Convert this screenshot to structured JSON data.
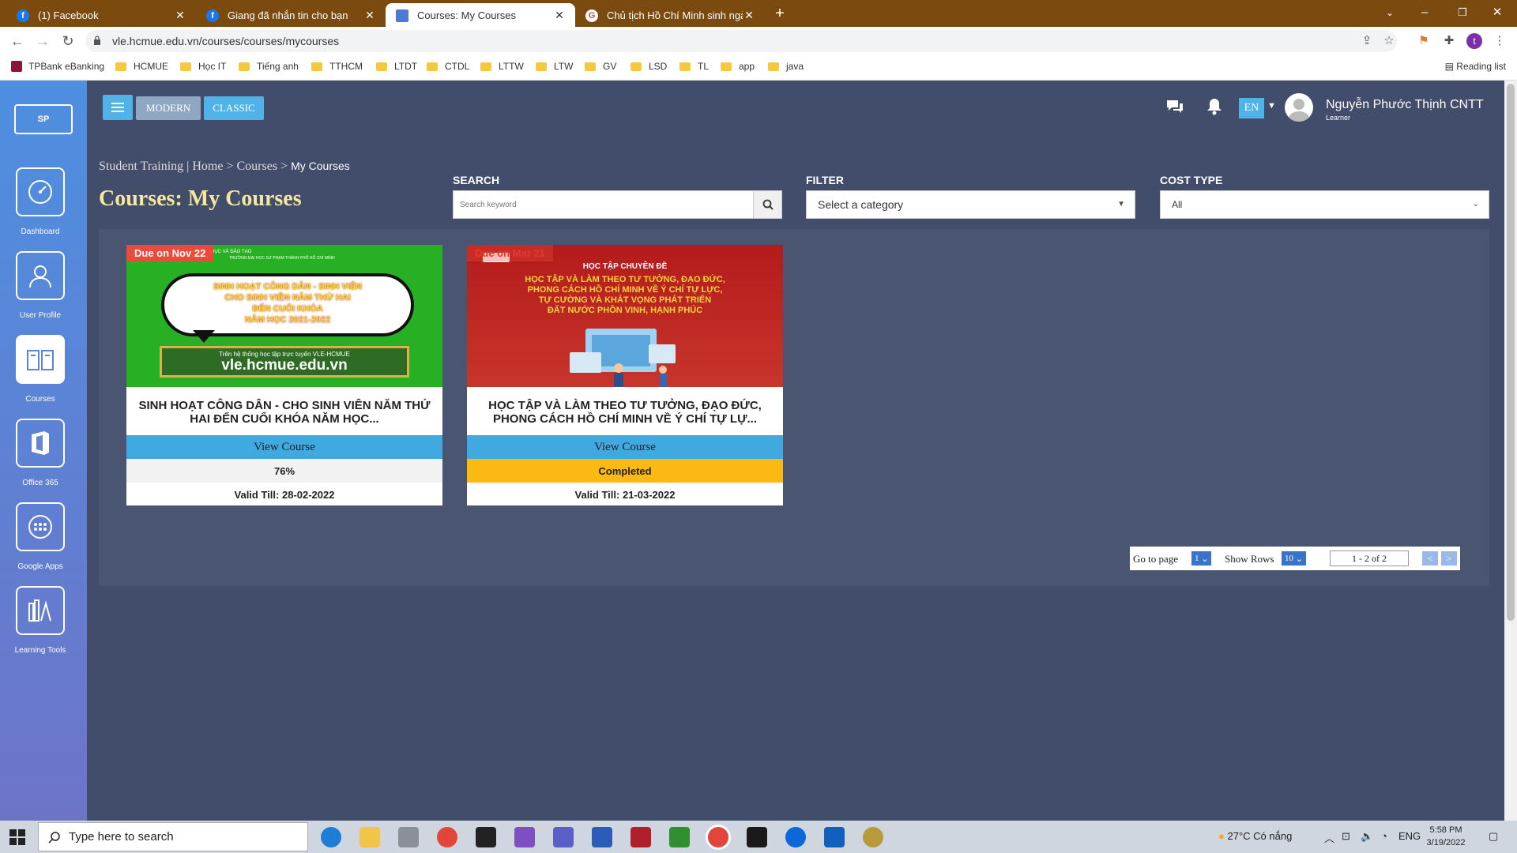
{
  "browser": {
    "tabs": [
      {
        "title": "(1) Facebook",
        "icon": "facebook-icon",
        "color": "#1877f2"
      },
      {
        "title": "Giang đã nhắn tin cho bạn",
        "icon": "facebook-icon",
        "color": "#1877f2"
      },
      {
        "title": "Courses: My Courses",
        "icon": "vle-icon",
        "color": "#4e7ad6"
      },
      {
        "title": "Chủ tịch Hồ Chí Minh sinh ngày",
        "icon": "google-icon",
        "color": "#ea4335"
      }
    ],
    "active_tab": 2,
    "url": "vle.hcmue.edu.vn/courses/courses/mycourses",
    "bookmarks": [
      "TPBank eBanking",
      "HCMUE",
      "Học IT",
      "Tiếng anh",
      "TTHCM",
      "LTDT",
      "CTDL",
      "LTTW",
      "LTW",
      "GV",
      "LSD",
      "TL",
      "app",
      "java"
    ],
    "reading_list": "Reading list",
    "profile_initial": "t"
  },
  "sidebar": {
    "logo_text": "SP",
    "items": [
      {
        "label": "Dashboard",
        "icon": "dashboard-icon"
      },
      {
        "label": "User Profile",
        "icon": "user-profile-icon"
      },
      {
        "label": "Courses",
        "icon": "courses-icon",
        "active": true
      },
      {
        "label": "Office 365",
        "icon": "office-365-icon"
      },
      {
        "label": "Google Apps",
        "icon": "google-apps-icon"
      },
      {
        "label": "Learning Tools",
        "icon": "learning-tools-icon"
      }
    ]
  },
  "header": {
    "modern_label": "MODERN",
    "classic_label": "CLASSIC",
    "language": "EN",
    "user_name": "Nguyễn Phước Thịnh CNTT",
    "user_role": "Learner"
  },
  "breadcrumb": {
    "root": "Student Training",
    "separator": "|",
    "home": "Home",
    "arrow": ">",
    "courses": "Courses",
    "current": "My Courses"
  },
  "page_title": "Courses: My Courses",
  "filters": {
    "search_label": "SEARCH",
    "search_placeholder": "Search keyword",
    "filter_label": "FILTER",
    "filter_value": "Select a category",
    "cost_label": "COST TYPE",
    "cost_value": "All"
  },
  "courses": [
    {
      "due": "Due on Nov 22",
      "title_line1": "SINH HOẠT CÔNG DÂN - CHO SINH VIÊN NĂM THỨ",
      "title_line2": "HAI ĐẾN CUỐI KHÓA NĂM HỌC...",
      "view_label": "View Course",
      "status": "76%",
      "status_color": "#f2f2f2",
      "valid": "Valid Till: 28-02-2022",
      "banner": {
        "top_text": "BỘ GIÁO DỤC VÀ ĐÀO TẠO",
        "top_text2": "TRƯỜNG ĐẠI HỌC SƯ PHẠM THÀNH PHỐ HỒ CHÍ MINH",
        "bubble_line1": "SINH HOẠT CÔNG DÂN - SINH VIÊN",
        "bubble_line2": "CHO SINH VIÊN NĂM THỨ HAI",
        "bubble_line3": "ĐẾN CUỐI KHÓA",
        "bubble_line4": "NĂM HỌC 2021-2022",
        "platform_text": "Trên hệ thống học tập trực tuyến VLE-HCMUE",
        "site": "vle.hcmue.edu.vn"
      }
    },
    {
      "due": "Due on Mar 21",
      "title_line1": "HỌC TẬP VÀ LÀM THEO TƯ TƯỞNG, ĐẠO ĐỨC,",
      "title_line2": "PHONG CÁCH HỒ CHÍ MINH VỀ Ý CHÍ TỰ LỰ...",
      "view_label": "View Course",
      "status": "Completed",
      "status_color": "#fdb913",
      "valid": "Valid Till: 21-03-2022",
      "banner": {
        "heading": "HỌC TẬP CHUYÊN ĐỀ",
        "line1": "HỌC TẬP VÀ LÀM THEO TƯ TƯỞNG, ĐẠO ĐỨC,",
        "line2": "PHONG CÁCH HỒ CHÍ MINH VỀ Ý CHÍ TỰ LỰC,",
        "line3": "TỰ CƯỜNG VÀ KHÁT VỌNG PHÁT TRIỂN",
        "line4": "ĐẤT NƯỚC PHỒN VINH, HẠNH PHÚC"
      }
    }
  ],
  "pager": {
    "goto_label": "Go to page",
    "page": "1",
    "rows_label": "Show Rows",
    "rows": "10",
    "range": "1 - 2 of 2",
    "prev": "<",
    "next": ">"
  },
  "taskbar": {
    "search_placeholder": "Type here to search",
    "weather": "27°C  Có nắng",
    "lang": "ENG",
    "time": "5:58 PM",
    "date": "3/19/2022"
  },
  "colors": {
    "page_bg": "#424d6b",
    "accent_blue": "#4fb3e8",
    "title_yellow": "#f5e89e",
    "due_red": "#ea4b3c",
    "completed_yellow": "#fdb913"
  }
}
